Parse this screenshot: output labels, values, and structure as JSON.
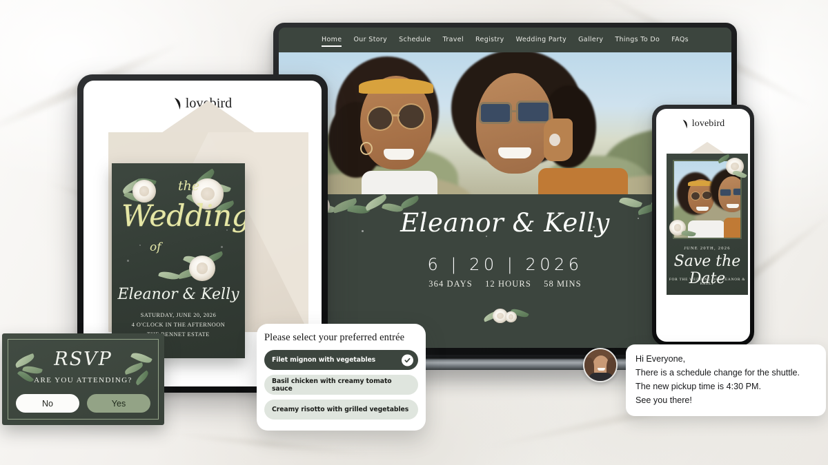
{
  "brand": {
    "name": "lovebird",
    "mark": "feather-icon"
  },
  "laptop": {
    "nav": [
      {
        "label": "Home",
        "active": true
      },
      {
        "label": "Our Story",
        "active": false
      },
      {
        "label": "Schedule",
        "active": false
      },
      {
        "label": "Travel",
        "active": false
      },
      {
        "label": "Registry",
        "active": false
      },
      {
        "label": "Wedding Party",
        "active": false
      },
      {
        "label": "Gallery",
        "active": false
      },
      {
        "label": "Things To Do",
        "active": false
      },
      {
        "label": "FAQs",
        "active": false
      }
    ],
    "hero": {
      "names": "Eleanor & Kelly",
      "date": "6  |  20  |  2026",
      "countdown": {
        "days": "364 DAYS",
        "hours": "12 HOURS",
        "mins": "58 MINS"
      }
    }
  },
  "invitation": {
    "the": "the",
    "wedding": "Wedding",
    "of": "of",
    "names": "Eleanor & Kelly",
    "line1": "SATURDAY, JUNE 20, 2026",
    "line2": "4 O'CLOCK IN THE AFTERNOON",
    "line3": "THE BENNET ESTATE"
  },
  "save_the_date": {
    "date": "JUNE 20TH, 2026",
    "title": "Save the Date",
    "subtitle": "FOR THE WEDDING OF ELEANOR & KELLY"
  },
  "rsvp": {
    "title": "RSVP",
    "question": "ARE YOU ATTENDING?",
    "no_label": "No",
    "yes_label": "Yes",
    "selected": "No"
  },
  "entree": {
    "title": "Please select your preferred entrée",
    "options": [
      {
        "label": "Filet mignon with vegetables",
        "selected": true
      },
      {
        "label": "Basil chicken with creamy tomato sauce",
        "selected": false
      },
      {
        "label": "Creamy risotto with grilled vegetables",
        "selected": false
      }
    ]
  },
  "message": {
    "line1": "Hi Everyone,",
    "line2": "There is a schedule change for the shuttle.",
    "line3": "The new pickup time is 4:30 PM.",
    "line4": "See you there!"
  },
  "colors": {
    "forest_green": "#3c453e",
    "sage": "#93a386",
    "gold_script": "#e6e7a6",
    "cream": "#efe9e0",
    "background": "#f2f1ee"
  }
}
